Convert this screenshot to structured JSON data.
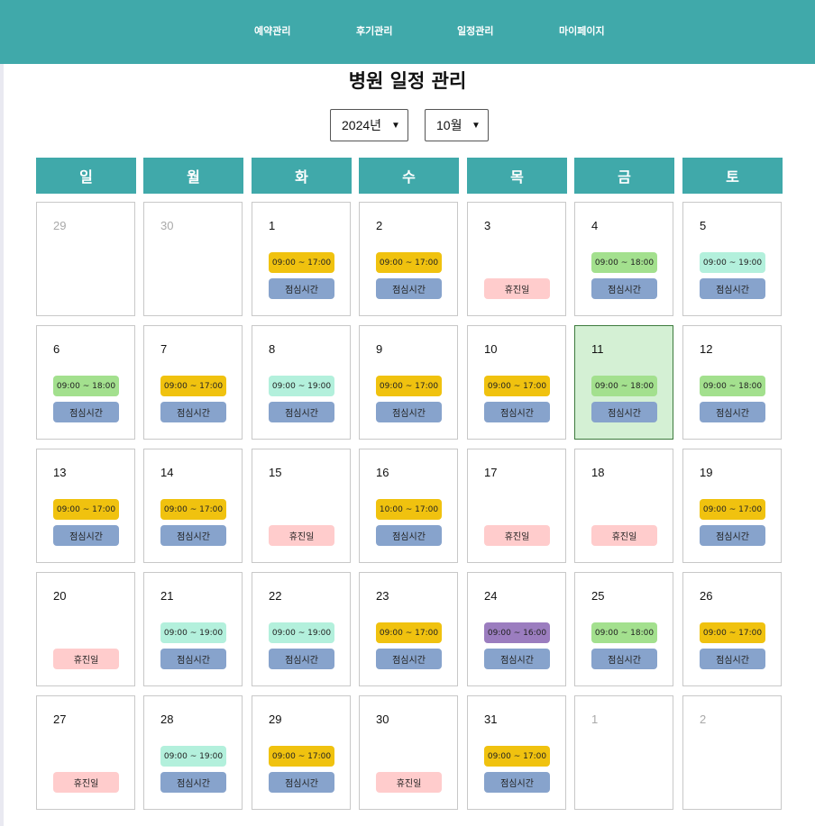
{
  "nav": [
    {
      "label": "예약관리"
    },
    {
      "label": "후기관리"
    },
    {
      "label": "일정관리"
    },
    {
      "label": "마이페이지"
    }
  ],
  "title": "병원 일정 관리",
  "year_select": {
    "value": "2024년"
  },
  "month_select": {
    "value": "10월"
  },
  "weekdays": [
    "일",
    "월",
    "화",
    "수",
    "목",
    "금",
    "토"
  ],
  "labels": {
    "lunch": "점심시간",
    "closed": "휴진일"
  },
  "colors": {
    "brand": "#40a9aa",
    "hours_9_17": "#f0c20f",
    "hours_9_18": "#a3e08e",
    "hours_9_19": "#b3f0dc",
    "hours_10_17": "#f0c20f",
    "hours_9_16": "#9b7dbf",
    "lunch": "#87a3cc",
    "closed": "#ffcccc",
    "today": "#d4f0d4"
  },
  "days": [
    {
      "date": "29",
      "other": true
    },
    {
      "date": "30",
      "other": true
    },
    {
      "date": "1",
      "hours": "09:00 ~ 17:00",
      "color": "#f0c20f",
      "lunch": true
    },
    {
      "date": "2",
      "hours": "09:00 ~ 17:00",
      "color": "#f0c20f",
      "lunch": true
    },
    {
      "date": "3",
      "closed": true
    },
    {
      "date": "4",
      "hours": "09:00 ~ 18:00",
      "color": "#a3e08e",
      "lunch": true
    },
    {
      "date": "5",
      "hours": "09:00 ~ 19:00",
      "color": "#b3f0dc",
      "lunch": true
    },
    {
      "date": "6",
      "hours": "09:00 ~ 18:00",
      "color": "#a3e08e",
      "lunch": true
    },
    {
      "date": "7",
      "hours": "09:00 ~ 17:00",
      "color": "#f0c20f",
      "lunch": true
    },
    {
      "date": "8",
      "hours": "09:00 ~ 19:00",
      "color": "#b3f0dc",
      "lunch": true
    },
    {
      "date": "9",
      "hours": "09:00 ~ 17:00",
      "color": "#f0c20f",
      "lunch": true
    },
    {
      "date": "10",
      "hours": "09:00 ~ 17:00",
      "color": "#f0c20f",
      "lunch": true
    },
    {
      "date": "11",
      "hours": "09:00 ~ 18:00",
      "color": "#a3e08e",
      "lunch": true,
      "today": true
    },
    {
      "date": "12",
      "hours": "09:00 ~ 18:00",
      "color": "#a3e08e",
      "lunch": true
    },
    {
      "date": "13",
      "hours": "09:00 ~ 17:00",
      "color": "#f0c20f",
      "lunch": true
    },
    {
      "date": "14",
      "hours": "09:00 ~ 17:00",
      "color": "#f0c20f",
      "lunch": true
    },
    {
      "date": "15",
      "closed": true
    },
    {
      "date": "16",
      "hours": "10:00 ~ 17:00",
      "color": "#f0c20f",
      "lunch": true
    },
    {
      "date": "17",
      "closed": true
    },
    {
      "date": "18",
      "closed": true
    },
    {
      "date": "19",
      "hours": "09:00 ~ 17:00",
      "color": "#f0c20f",
      "lunch": true
    },
    {
      "date": "20",
      "closed": true
    },
    {
      "date": "21",
      "hours": "09:00 ~ 19:00",
      "color": "#b3f0dc",
      "lunch": true
    },
    {
      "date": "22",
      "hours": "09:00 ~ 19:00",
      "color": "#b3f0dc",
      "lunch": true
    },
    {
      "date": "23",
      "hours": "09:00 ~ 17:00",
      "color": "#f0c20f",
      "lunch": true
    },
    {
      "date": "24",
      "hours": "09:00 ~ 16:00",
      "color": "#9b7dbf",
      "lunch": true
    },
    {
      "date": "25",
      "hours": "09:00 ~ 18:00",
      "color": "#a3e08e",
      "lunch": true
    },
    {
      "date": "26",
      "hours": "09:00 ~ 17:00",
      "color": "#f0c20f",
      "lunch": true
    },
    {
      "date": "27",
      "closed": true
    },
    {
      "date": "28",
      "hours": "09:00 ~ 19:00",
      "color": "#b3f0dc",
      "lunch": true
    },
    {
      "date": "29",
      "hours": "09:00 ~ 17:00",
      "color": "#f0c20f",
      "lunch": true
    },
    {
      "date": "30",
      "closed": true
    },
    {
      "date": "31",
      "hours": "09:00 ~ 17:00",
      "color": "#f0c20f",
      "lunch": true
    },
    {
      "date": "1",
      "other": true
    },
    {
      "date": "2",
      "other": true
    }
  ]
}
